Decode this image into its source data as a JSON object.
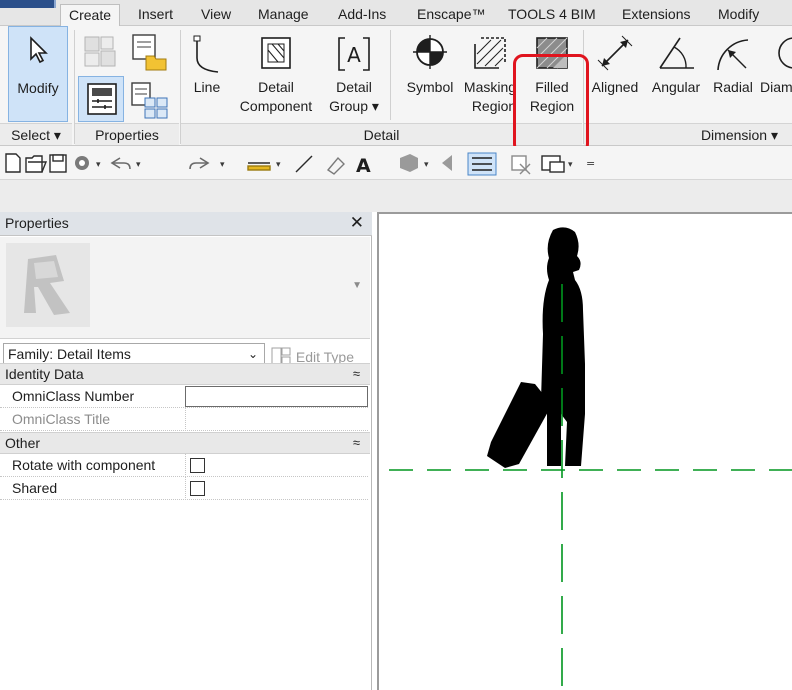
{
  "tabs": [
    "Create",
    "Insert",
    "View",
    "Manage",
    "Add-Ins",
    "Enscape™",
    "TOOLS 4 BIM",
    "Extensions",
    "Modify"
  ],
  "active_tab": "Create",
  "ribbon": {
    "modify_label": "Modify",
    "select_label": "Select ▾",
    "properties_group_label": "Properties",
    "detail_group_label": "Detail",
    "dimension_group_label": "Dimension ▾",
    "tools": {
      "line": "Line",
      "detail_component_1": "Detail",
      "detail_component_2": "Component",
      "detail_group_1": "Detail",
      "detail_group_2": "Group ▾",
      "symbol": "Symbol",
      "masking_region_1": "Masking",
      "masking_region_2": "Region",
      "filled_region_1": "Filled",
      "filled_region_2": "Region",
      "aligned": "Aligned",
      "angular": "Angular",
      "radial": "Radial",
      "diameter": "Diam"
    }
  },
  "properties": {
    "title": "Properties",
    "close": "✕",
    "family_select": "Family: Detail Items",
    "edit_type": "Edit Type",
    "sections": [
      {
        "label": "Identity Data",
        "rows": [
          {
            "name": "OmniClass Number",
            "value": ""
          },
          {
            "name": "OmniClass Title",
            "value": ""
          }
        ]
      },
      {
        "label": "Other",
        "rows": [
          {
            "name": "Rotate with component",
            "checked": false
          },
          {
            "name": "Shared",
            "checked": false
          }
        ]
      }
    ]
  },
  "colors": {
    "highlight": "#e0141e",
    "reference_line": "#00961e",
    "ribbon_bg": "#f5f5f5"
  },
  "icons": [
    "pointer-icon",
    "family-icon",
    "load-family-icon",
    "type-properties-icon",
    "family-category-icon",
    "line-icon",
    "detail-component-icon",
    "detail-group-icon",
    "symbol-icon",
    "masking-region-icon",
    "filled-region-icon",
    "aligned-dimension-icon",
    "angular-dimension-icon",
    "radial-dimension-icon",
    "diameter-dimension-icon",
    "close-icon",
    "edit-type-icon"
  ]
}
